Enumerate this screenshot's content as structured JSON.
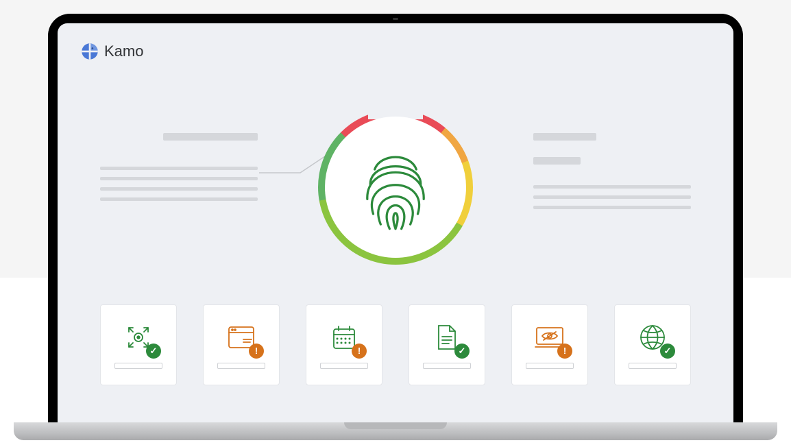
{
  "brand": {
    "name": "Kamo"
  },
  "dial": {
    "icon": "fingerprint-icon"
  },
  "cards": [
    {
      "icon": "target-icon",
      "status": "ok"
    },
    {
      "icon": "browser-icon",
      "status": "warn"
    },
    {
      "icon": "calendar-icon",
      "status": "warn"
    },
    {
      "icon": "document-icon",
      "status": "ok"
    },
    {
      "icon": "privacy-eye-icon",
      "status": "warn"
    },
    {
      "icon": "globe-icon",
      "status": "ok"
    }
  ],
  "colors": {
    "ok": "#2c8a3b",
    "warn": "#d6721b",
    "outline_green": "#2c8a3b",
    "outline_orange": "#d6721b"
  }
}
